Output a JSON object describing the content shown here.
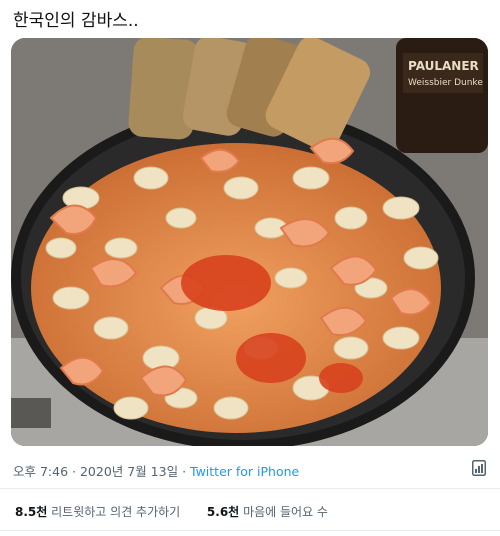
{
  "tweet": {
    "text": "한국인의 감바스..",
    "timestamp": "오후 7:46 · 2020년 7월 13일",
    "separator": " · ",
    "source": "Twitter for iPhone"
  },
  "photo": {
    "bottle_label_line1": "PAULANER",
    "bottle_label_line2": "Weissbier Dunke"
  },
  "stats": {
    "retweets_count": "8.5천",
    "retweets_label": "리트윗하고 의견 추가하기",
    "likes_count": "5.6천",
    "likes_label": "마음에 들어요 수"
  },
  "icons": [
    "analytics-icon"
  ]
}
